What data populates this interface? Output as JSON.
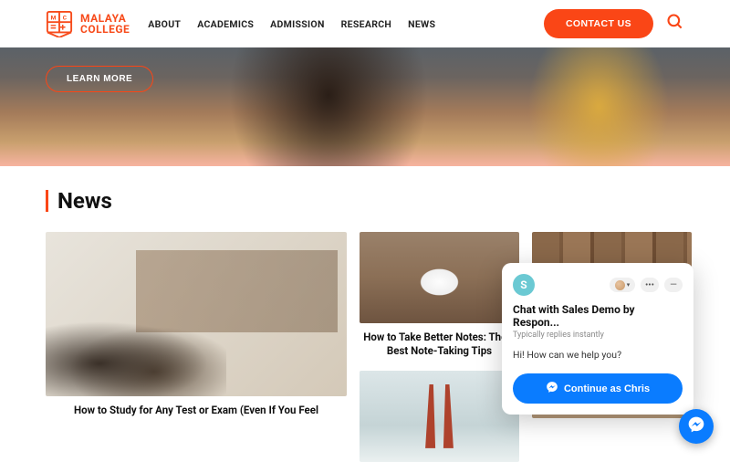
{
  "brand": {
    "line1": "MALAYA",
    "line2": "COLLEGE"
  },
  "nav": {
    "items": [
      "ABOUT",
      "ACADEMICS",
      "ADMISSION",
      "RESEARCH",
      "NEWS"
    ]
  },
  "header": {
    "contact": "CONTACT US"
  },
  "hero": {
    "learn_more": "LEARN MORE"
  },
  "section": {
    "title": "News"
  },
  "cards": {
    "main": "How to Study for Any Test or Exam (Even If You Feel",
    "notes": "How to Take Better Notes: The 6 Best Note-Taking Tips"
  },
  "chat": {
    "avatar_initial": "S",
    "title": "Chat with Sales Demo by Respon...",
    "subtitle": "Typically replies instantly",
    "message": "Hi! How can we help you?",
    "button": "Continue as Chris"
  }
}
